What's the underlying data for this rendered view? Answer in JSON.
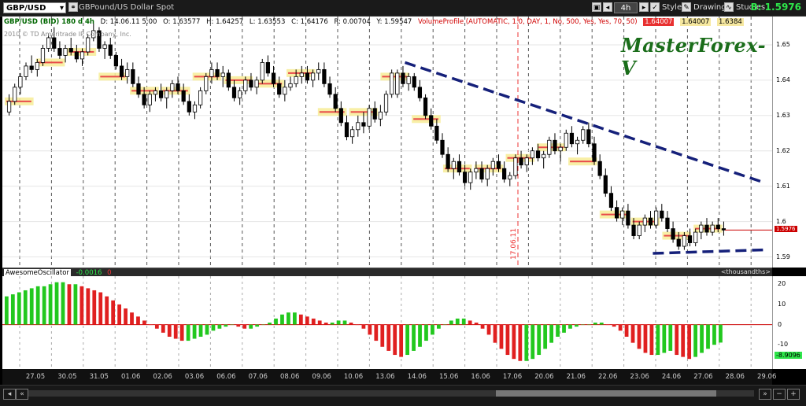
{
  "toolbar": {
    "symbol": "GBP/USD",
    "description": "GBPound/US Dollar Spot",
    "timeframe": "4h",
    "style_label": "Style",
    "drawings_label": "Drawings",
    "studies_label": "Studies",
    "bid_label": "B: 1.5976"
  },
  "info": {
    "title": "GBP/USD (BID) 180 d 4h",
    "date": "D: 14.06.11 5:00",
    "open": "O: 1.63577",
    "high": "H: 1.64257",
    "low": "L: 1.63553",
    "close": "C: 1.64176",
    "range": "R: 0.00704",
    "y": "Y: 1.59547",
    "volprofile": "VolumeProfile (AUTOMATIC, 1.0, DAY, 1, No, 500, Yes, Yes, 70, 50)",
    "vp1": "1.64007",
    "vp2": "1.64007",
    "vp3": "1.6384",
    "copyright": "2010 © TD Ameritrade IP Company, Inc."
  },
  "watermark": "MasterForex-V",
  "vline_label": "17.06.11",
  "price_axis": {
    "labels": [
      "1.65",
      "1.64",
      "1.63",
      "1.62",
      "1.61",
      "1.6",
      "1.59"
    ],
    "values": [
      1.65,
      1.64,
      1.63,
      1.62,
      1.61,
      1.6,
      1.59
    ],
    "last": "1.5976",
    "last_value": 1.5976
  },
  "oscillator": {
    "name": "AwesomeOscillator",
    "value": "-0.0016",
    "flag": "0",
    "units": "<thousandths>",
    "axis_labels": [
      "20",
      "10",
      "0",
      "-10"
    ],
    "axis_values": [
      20,
      10,
      0,
      -10
    ],
    "last": "-8.9096"
  },
  "date_axis": {
    "labels": [
      "27.05",
      "30.05",
      "31.05",
      "01.06",
      "02.06",
      "03.06",
      "06.06",
      "07.06",
      "08.06",
      "09.06",
      "10.06",
      "13.06",
      "14.06",
      "15.06",
      "16.06",
      "17.06",
      "20.06",
      "21.06",
      "22.06",
      "23.06",
      "24.06",
      "27.06",
      "28.06",
      "29.06"
    ]
  },
  "chart_data": {
    "type": "candlestick",
    "symbol": "GBP/USD",
    "timeframe": "4h",
    "ylim": [
      1.587,
      1.658
    ],
    "candles_ohlc": [
      [
        1.631,
        1.636,
        1.63,
        1.634
      ],
      [
        1.634,
        1.639,
        1.633,
        1.638
      ],
      [
        1.638,
        1.642,
        1.636,
        1.641
      ],
      [
        1.641,
        1.645,
        1.64,
        1.644
      ],
      [
        1.644,
        1.647,
        1.642,
        1.643
      ],
      [
        1.643,
        1.646,
        1.641,
        1.645
      ],
      [
        1.645,
        1.65,
        1.644,
        1.649
      ],
      [
        1.649,
        1.653,
        1.648,
        1.652
      ],
      [
        1.652,
        1.655,
        1.648,
        1.649
      ],
      [
        1.649,
        1.651,
        1.646,
        1.647
      ],
      [
        1.647,
        1.65,
        1.645,
        1.649
      ],
      [
        1.649,
        1.652,
        1.647,
        1.648
      ],
      [
        1.648,
        1.65,
        1.645,
        1.646
      ],
      [
        1.646,
        1.649,
        1.644,
        1.648
      ],
      [
        1.648,
        1.653,
        1.647,
        1.652
      ],
      [
        1.652,
        1.656,
        1.651,
        1.654
      ],
      [
        1.654,
        1.655,
        1.648,
        1.649
      ],
      [
        1.649,
        1.651,
        1.646,
        1.65
      ],
      [
        1.65,
        1.652,
        1.646,
        1.647
      ],
      [
        1.647,
        1.648,
        1.643,
        1.644
      ],
      [
        1.644,
        1.646,
        1.64,
        1.641
      ],
      [
        1.641,
        1.645,
        1.639,
        1.643
      ],
      [
        1.643,
        1.645,
        1.638,
        1.639
      ],
      [
        1.639,
        1.641,
        1.635,
        1.636
      ],
      [
        1.636,
        1.638,
        1.632,
        1.633
      ],
      [
        1.633,
        1.637,
        1.631,
        1.636
      ],
      [
        1.636,
        1.638,
        1.634,
        1.637
      ],
      [
        1.637,
        1.639,
        1.634,
        1.635
      ],
      [
        1.635,
        1.638,
        1.632,
        1.637
      ],
      [
        1.637,
        1.64,
        1.635,
        1.639
      ],
      [
        1.639,
        1.641,
        1.636,
        1.637
      ],
      [
        1.637,
        1.639,
        1.633,
        1.634
      ],
      [
        1.634,
        1.636,
        1.63,
        1.631
      ],
      [
        1.631,
        1.634,
        1.629,
        1.633
      ],
      [
        1.633,
        1.638,
        1.632,
        1.637
      ],
      [
        1.637,
        1.642,
        1.636,
        1.641
      ],
      [
        1.641,
        1.645,
        1.639,
        1.643
      ],
      [
        1.643,
        1.645,
        1.64,
        1.641
      ],
      [
        1.641,
        1.644,
        1.638,
        1.642
      ],
      [
        1.642,
        1.643,
        1.637,
        1.638
      ],
      [
        1.638,
        1.64,
        1.634,
        1.635
      ],
      [
        1.635,
        1.638,
        1.633,
        1.637
      ],
      [
        1.637,
        1.641,
        1.636,
        1.64
      ],
      [
        1.64,
        1.642,
        1.637,
        1.638
      ],
      [
        1.638,
        1.641,
        1.636,
        1.64
      ],
      [
        1.64,
        1.646,
        1.639,
        1.645
      ],
      [
        1.645,
        1.647,
        1.641,
        1.642
      ],
      [
        1.642,
        1.644,
        1.638,
        1.639
      ],
      [
        1.639,
        1.641,
        1.635,
        1.636
      ],
      [
        1.636,
        1.64,
        1.634,
        1.638
      ],
      [
        1.638,
        1.641,
        1.637,
        1.639
      ],
      [
        1.639,
        1.643,
        1.638,
        1.641
      ],
      [
        1.641,
        1.644,
        1.639,
        1.642
      ],
      [
        1.642,
        1.644,
        1.639,
        1.64
      ],
      [
        1.64,
        1.643,
        1.638,
        1.642
      ],
      [
        1.642,
        1.645,
        1.64,
        1.643
      ],
      [
        1.643,
        1.645,
        1.638,
        1.639
      ],
      [
        1.639,
        1.641,
        1.635,
        1.636
      ],
      [
        1.636,
        1.638,
        1.631,
        1.632
      ],
      [
        1.632,
        1.634,
        1.627,
        1.628
      ],
      [
        1.628,
        1.63,
        1.623,
        1.624
      ],
      [
        1.624,
        1.627,
        1.622,
        1.626
      ],
      [
        1.626,
        1.63,
        1.624,
        1.628
      ],
      [
        1.628,
        1.631,
        1.625,
        1.627
      ],
      [
        1.627,
        1.633,
        1.626,
        1.632
      ],
      [
        1.632,
        1.634,
        1.628,
        1.629
      ],
      [
        1.629,
        1.633,
        1.627,
        1.631
      ],
      [
        1.631,
        1.637,
        1.63,
        1.636
      ],
      [
        1.636,
        1.643,
        1.635,
        1.642
      ],
      [
        1.636,
        1.643,
        1.635,
        1.642
      ],
      [
        1.642,
        1.644,
        1.638,
        1.639
      ],
      [
        1.639,
        1.642,
        1.637,
        1.641
      ],
      [
        1.641,
        1.642,
        1.637,
        1.638
      ],
      [
        1.638,
        1.64,
        1.634,
        1.635
      ],
      [
        1.635,
        1.636,
        1.629,
        1.63
      ],
      [
        1.63,
        1.632,
        1.626,
        1.627
      ],
      [
        1.627,
        1.629,
        1.622,
        1.623
      ],
      [
        1.623,
        1.625,
        1.618,
        1.619
      ],
      [
        1.619,
        1.621,
        1.614,
        1.615
      ],
      [
        1.615,
        1.618,
        1.612,
        1.617
      ],
      [
        1.617,
        1.619,
        1.613,
        1.614
      ],
      [
        1.614,
        1.616,
        1.61,
        1.611
      ],
      [
        1.611,
        1.615,
        1.609,
        1.614
      ],
      [
        1.614,
        1.617,
        1.612,
        1.615
      ],
      [
        1.615,
        1.617,
        1.611,
        1.612
      ],
      [
        1.612,
        1.616,
        1.61,
        1.615
      ],
      [
        1.615,
        1.618,
        1.613,
        1.617
      ],
      [
        1.617,
        1.619,
        1.614,
        1.615
      ],
      [
        1.615,
        1.617,
        1.611,
        1.612
      ],
      [
        1.612,
        1.614,
        1.61,
        1.613
      ],
      [
        1.613,
        1.619,
        1.612,
        1.618
      ],
      [
        1.618,
        1.62,
        1.615,
        1.616
      ],
      [
        1.616,
        1.619,
        1.614,
        1.618
      ],
      [
        1.618,
        1.621,
        1.616,
        1.62
      ],
      [
        1.62,
        1.622,
        1.617,
        1.618
      ],
      [
        1.618,
        1.62,
        1.615,
        1.619
      ],
      [
        1.619,
        1.624,
        1.618,
        1.623
      ],
      [
        1.623,
        1.625,
        1.619,
        1.62
      ],
      [
        1.62,
        1.622,
        1.617,
        1.621
      ],
      [
        1.621,
        1.626,
        1.62,
        1.625
      ],
      [
        1.625,
        1.627,
        1.621,
        1.622
      ],
      [
        1.622,
        1.624,
        1.619,
        1.623
      ],
      [
        1.623,
        1.627,
        1.622,
        1.626
      ],
      [
        1.626,
        1.628,
        1.621,
        1.622
      ],
      [
        1.622,
        1.624,
        1.616,
        1.617
      ],
      [
        1.617,
        1.619,
        1.612,
        1.613
      ],
      [
        1.613,
        1.615,
        1.607,
        1.608
      ],
      [
        1.608,
        1.61,
        1.603,
        1.604
      ],
      [
        1.604,
        1.606,
        1.6,
        1.601
      ],
      [
        1.601,
        1.604,
        1.599,
        1.603
      ],
      [
        1.603,
        1.605,
        1.598,
        1.599
      ],
      [
        1.599,
        1.601,
        1.595,
        1.596
      ],
      [
        1.596,
        1.6,
        1.595,
        1.599
      ],
      [
        1.599,
        1.602,
        1.597,
        1.601
      ],
      [
        1.601,
        1.603,
        1.598,
        1.599
      ],
      [
        1.599,
        1.604,
        1.598,
        1.603
      ],
      [
        1.603,
        1.605,
        1.6,
        1.601
      ],
      [
        1.601,
        1.603,
        1.597,
        1.598
      ],
      [
        1.598,
        1.6,
        1.594,
        1.595
      ],
      [
        1.595,
        1.597,
        1.592,
        1.593
      ],
      [
        1.593,
        1.597,
        1.592,
        1.596
      ],
      [
        1.596,
        1.598,
        1.593,
        1.594
      ],
      [
        1.594,
        1.598,
        1.593,
        1.597
      ],
      [
        1.597,
        1.6,
        1.595,
        1.599
      ],
      [
        1.599,
        1.601,
        1.596,
        1.597
      ],
      [
        1.597,
        1.6,
        1.596,
        1.599
      ],
      [
        1.599,
        1.601,
        1.597,
        1.598
      ],
      [
        1.598,
        1.6,
        1.596,
        1.5976
      ]
    ],
    "volume_profile_levels": [
      1.634,
      1.645,
      1.648,
      1.641,
      1.637,
      1.637,
      1.641,
      1.64,
      1.639,
      1.642,
      1.631,
      1.631,
      1.641,
      1.629,
      1.615,
      1.615,
      1.618,
      1.621,
      1.617,
      1.602,
      1.6,
      1.596,
      1.598
    ],
    "trendlines": [
      {
        "name": "upper-resistance",
        "from": [
          0.523,
          1.645
        ],
        "to": [
          0.99,
          1.611
        ]
      },
      {
        "name": "lower-support",
        "from": [
          0.845,
          1.591
        ],
        "to": [
          0.99,
          1.592
        ]
      }
    ],
    "awesome_oscillator": [
      14,
      15,
      16,
      17,
      18,
      19,
      19,
      20,
      21,
      21,
      20,
      20,
      19,
      18,
      17,
      16,
      14,
      12,
      10,
      8,
      6,
      4,
      2,
      0,
      -2,
      -4,
      -6,
      -7,
      -8,
      -8,
      -7,
      -6,
      -5,
      -3,
      -2,
      -1,
      0,
      -1,
      -2,
      -2,
      -1,
      0,
      1,
      3,
      5,
      6,
      6,
      5,
      4,
      3,
      2,
      1,
      1,
      2,
      2,
      1,
      0,
      -2,
      -5,
      -8,
      -11,
      -13,
      -15,
      -16,
      -15,
      -13,
      -11,
      -8,
      -5,
      -2,
      0,
      2,
      3,
      3,
      2,
      1,
      -2,
      -5,
      -9,
      -12,
      -15,
      -17,
      -18,
      -18,
      -17,
      -15,
      -12,
      -9,
      -6,
      -4,
      -2,
      -1,
      0,
      0,
      1,
      1,
      0,
      -1,
      -3,
      -6,
      -9,
      -12,
      -14,
      -15,
      -15,
      -14,
      -13,
      -15,
      -16,
      -17,
      -16,
      -14,
      -12,
      -10,
      -8.9
    ]
  }
}
